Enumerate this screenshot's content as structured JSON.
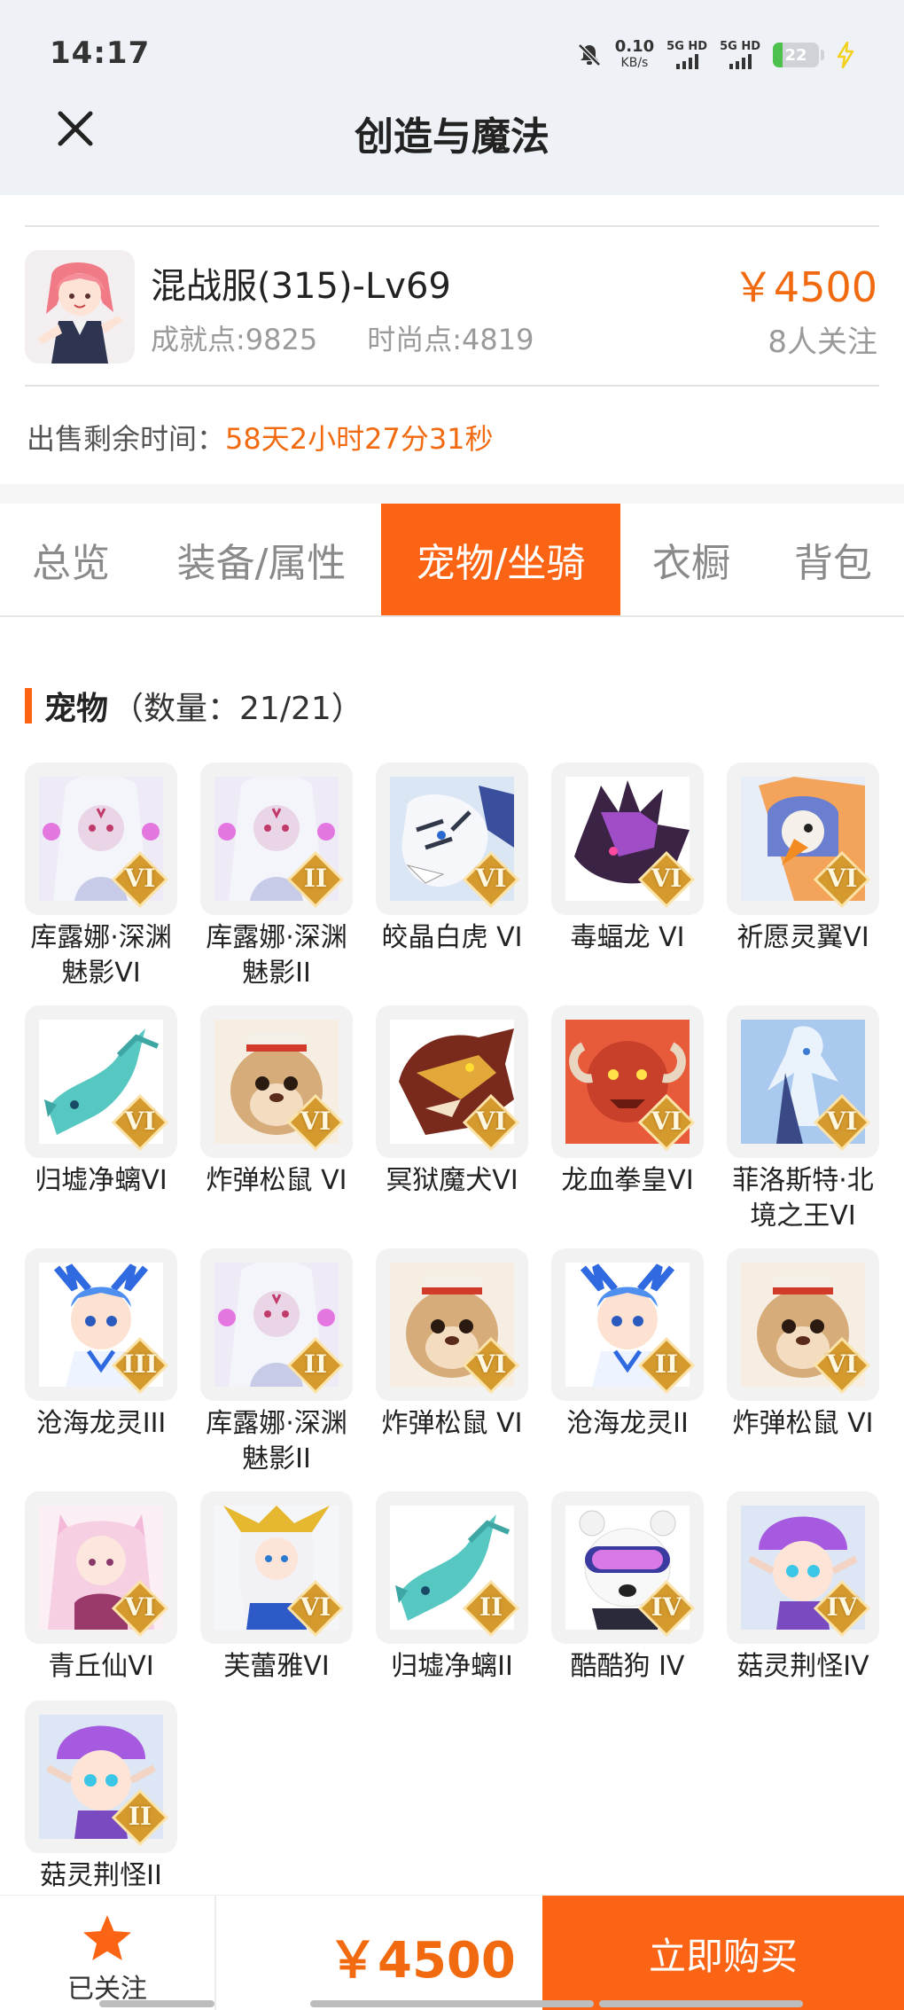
{
  "status_bar": {
    "time": "14:17",
    "net_speed_value": "0.10",
    "net_speed_unit": "KB/s",
    "sim1": "5G HD",
    "sim2": "5G HD",
    "battery": "22",
    "battery_level_percent": 22
  },
  "header": {
    "title": "创造与魔法"
  },
  "account": {
    "name": "混战服(315)-Lv69",
    "achievement": "成就点:9825",
    "fashion": "时尚点:4819",
    "price": "￥4500",
    "followers": "8人关注",
    "sale_time_label": "出售剩余时间：",
    "sale_time_value": "58天2小时27分31秒"
  },
  "tabs": [
    "总览",
    "装备/属性",
    "宠物/坐骑",
    "衣橱",
    "背包"
  ],
  "active_tab": "宠物/坐骑",
  "pets_section": {
    "title": "宠物",
    "count": "（数量：21/21）"
  },
  "pets": [
    {
      "name": "库露娜·深渊魅影VI",
      "grade": "VI",
      "icon": "ghost-maiden-icon",
      "color": "#e6e2f2"
    },
    {
      "name": "库露娜·深渊魅影II",
      "grade": "II",
      "icon": "ghost-maiden-icon",
      "color": "#e6e2f2"
    },
    {
      "name": "皎晶白虎 VI",
      "grade": "VI",
      "icon": "white-tiger-icon",
      "color": "#bcd2ee"
    },
    {
      "name": "毒蝠龙 VI",
      "grade": "VI",
      "icon": "bat-dragon-icon",
      "color": "#5c2a78"
    },
    {
      "name": "祈愿灵翼VI",
      "grade": "VI",
      "icon": "griffin-icon",
      "color": "#e88a44"
    },
    {
      "name": "归墟净螭VI",
      "grade": "VI",
      "icon": "jade-dragon-icon",
      "color": "#5fc9c4"
    },
    {
      "name": "炸弹松鼠 VI",
      "grade": "VI",
      "icon": "bomb-squirrel-icon",
      "color": "#c79a66"
    },
    {
      "name": "冥狱魔犬VI",
      "grade": "VI",
      "icon": "hell-hound-icon",
      "color": "#8a3d2a"
    },
    {
      "name": "龙血拳皇VI",
      "grade": "VI",
      "icon": "dragon-fighter-icon",
      "color": "#d45a3a"
    },
    {
      "name": "菲洛斯特·北境之王VI",
      "grade": "VI",
      "icon": "frost-king-icon",
      "color": "#9fc4e8"
    },
    {
      "name": "沧海龙灵III",
      "grade": "III",
      "icon": "sea-dragon-spirit-icon",
      "color": "#6aaef0"
    },
    {
      "name": "库露娜·深渊魅影II",
      "grade": "II",
      "icon": "ghost-maiden-icon",
      "color": "#e6e2f2"
    },
    {
      "name": "炸弹松鼠 VI",
      "grade": "VI",
      "icon": "bomb-squirrel-icon",
      "color": "#c79a66"
    },
    {
      "name": "沧海龙灵II",
      "grade": "II",
      "icon": "sea-dragon-spirit-icon",
      "color": "#6aaef0"
    },
    {
      "name": "炸弹松鼠 VI",
      "grade": "VI",
      "icon": "bomb-squirrel-icon",
      "color": "#c79a66"
    },
    {
      "name": "青丘仙VI",
      "grade": "VI",
      "icon": "fox-fairy-icon",
      "color": "#f1c6dc"
    },
    {
      "name": "芙蕾雅VI",
      "grade": "VI",
      "icon": "valkyrie-icon",
      "color": "#f0dc92"
    },
    {
      "name": "归墟净螭II",
      "grade": "II",
      "icon": "jade-dragon-icon",
      "color": "#5fc9c4"
    },
    {
      "name": "酷酷狗 IV",
      "grade": "IV",
      "icon": "cool-dog-icon",
      "color": "#e2e6f4"
    },
    {
      "name": "菇灵荆怪IV",
      "grade": "IV",
      "icon": "mushroom-elf-icon",
      "color": "#c99ae6"
    },
    {
      "name": "菇灵荆怪II",
      "grade": "II",
      "icon": "mushroom-elf-icon",
      "color": "#c99ae6"
    }
  ],
  "bottom_bar": {
    "follow_label": "已关注",
    "price": "￥4500",
    "buy_label": "立即购买"
  },
  "colors": {
    "accent": "#fb6414",
    "price": "#f26a10",
    "grade_badge": "#d49a2e"
  }
}
